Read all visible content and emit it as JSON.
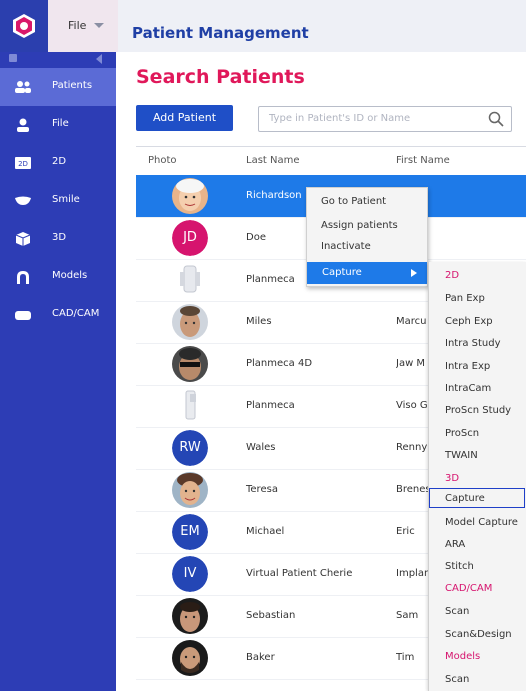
{
  "topbar": {
    "file_label": "File",
    "title": "Patient Management"
  },
  "sidebar": {
    "items": [
      {
        "label": "Patients",
        "icon": "patients-icon",
        "active": true
      },
      {
        "label": "File",
        "icon": "person-icon"
      },
      {
        "label": "2D",
        "icon": "2d-icon"
      },
      {
        "label": "Smile",
        "icon": "smile-icon"
      },
      {
        "label": "3D",
        "icon": "3d-icon"
      },
      {
        "label": "Models",
        "icon": "models-icon"
      },
      {
        "label": "CAD/CAM",
        "icon": "cadcam-icon"
      }
    ]
  },
  "main": {
    "title": "Search Patients",
    "add_button": "Add Patient",
    "search_placeholder": "Type in Patient's ID or Name",
    "columns": [
      "Photo",
      "Last Name",
      "First Name"
    ],
    "rows": [
      {
        "last": "Richardson",
        "first": "",
        "initials": ""
      },
      {
        "last": "Doe",
        "first": "",
        "initials": "JD"
      },
      {
        "last": "Planmeca",
        "first": "",
        "initials": ""
      },
      {
        "last": "Miles",
        "first": "Marcu",
        "initials": ""
      },
      {
        "last": "Planmeca 4D",
        "first": "Jaw M",
        "initials": ""
      },
      {
        "last": "Planmeca",
        "first": "Viso G",
        "initials": ""
      },
      {
        "last": "Wales",
        "first": "Renny",
        "initials": "RW"
      },
      {
        "last": "Teresa",
        "first": "Brenes",
        "initials": ""
      },
      {
        "last": "Michael",
        "first": "Eric",
        "initials": "EM"
      },
      {
        "last": "Virtual Patient Cherie",
        "first": "Implan",
        "initials": "IV"
      },
      {
        "last": "Sebastian",
        "first": "Sam",
        "initials": ""
      },
      {
        "last": "Baker",
        "first": "Tim",
        "initials": ""
      }
    ]
  },
  "context_menu": {
    "items": [
      "Go to Patient",
      "Assign patients",
      "Inactivate"
    ],
    "capture": "Capture"
  },
  "capture_submenu": [
    {
      "label": "2D",
      "header": true
    },
    {
      "label": "Pan Exp"
    },
    {
      "label": "Ceph Exp"
    },
    {
      "label": "Intra Study"
    },
    {
      "label": "Intra Exp"
    },
    {
      "label": "IntraCam"
    },
    {
      "label": "ProScn Study"
    },
    {
      "label": "ProScn"
    },
    {
      "label": "TWAIN"
    },
    {
      "label": "3D",
      "header": true
    },
    {
      "label": "Capture",
      "highlight": true
    },
    {
      "label": "Model Capture"
    },
    {
      "label": "ARA"
    },
    {
      "label": "Stitch"
    },
    {
      "label": "CAD/CAM",
      "header": true
    },
    {
      "label": "Scan"
    },
    {
      "label": "Scan&Design"
    },
    {
      "label": "Models",
      "header": true
    },
    {
      "label": "Scan"
    }
  ],
  "colors": {
    "brand_blue": "#2d3db5",
    "accent_pink": "#e0185a",
    "selection": "#1e7ae8"
  }
}
